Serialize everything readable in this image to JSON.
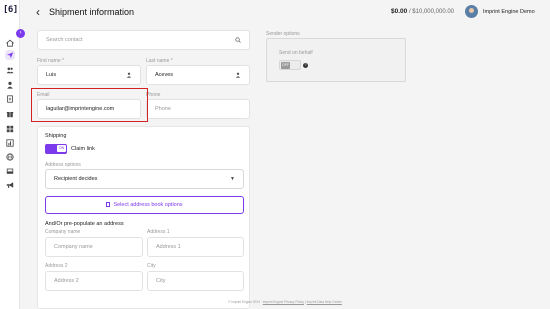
{
  "brand": {
    "logo_text": "[6]",
    "accent": "#7c3aed"
  },
  "sidebar": {
    "collapse_badge": "›",
    "items": [
      {
        "icon": "home-icon"
      },
      {
        "icon": "send-icon",
        "active": true
      },
      {
        "icon": "people-icon"
      },
      {
        "icon": "user-icon"
      },
      {
        "icon": "document-icon"
      },
      {
        "icon": "gift-icon"
      },
      {
        "icon": "grid-icon"
      },
      {
        "icon": "chart-icon"
      },
      {
        "icon": "globe-icon"
      },
      {
        "icon": "inbox-icon"
      },
      {
        "icon": "megaphone-icon"
      }
    ]
  },
  "header": {
    "back_glyph": "‹",
    "title": "Shipment information",
    "balance_amount": "$0.00",
    "balance_limit": "/ $10,000,000.00",
    "user_name": "Imprint Engine Demo"
  },
  "form": {
    "search_placeholder": "Search contact",
    "first_name_label": "First name *",
    "first_name_value": "Luis",
    "last_name_label": "Last name *",
    "last_name_value": "Aceves",
    "email_label": "Email",
    "email_value": "laguilar@imprintengine.com",
    "phone_label": "Phone",
    "phone_placeholder": "Phone"
  },
  "shipping": {
    "section_title": "Shipping",
    "claim_link_toggle": "ON",
    "claim_link_label": "Claim link",
    "address_options_label": "Address options",
    "address_options_value": "Recipient decides",
    "address_book_button": "Select address book options",
    "prepopulate_title": "And/Or pre-populate an address",
    "company_label": "Company name",
    "company_placeholder": "Company name",
    "address1_label": "Address 1",
    "address1_placeholder": "Address 1",
    "address2_label": "Address 2",
    "address2_placeholder": "Address 2",
    "city_label": "City",
    "city_placeholder": "City"
  },
  "sender": {
    "section_title": "Sender options",
    "send_on_behalf_label": "Send on behalf",
    "toggle_state": "OFF",
    "help_glyph": "?"
  },
  "footer": {
    "copyright": "© Imprint Engine 2024 · ",
    "privacy_link": "Imprint Engine Privacy Policy",
    "separator": " | ",
    "data_center_link": "Imprint Data Help Center"
  }
}
